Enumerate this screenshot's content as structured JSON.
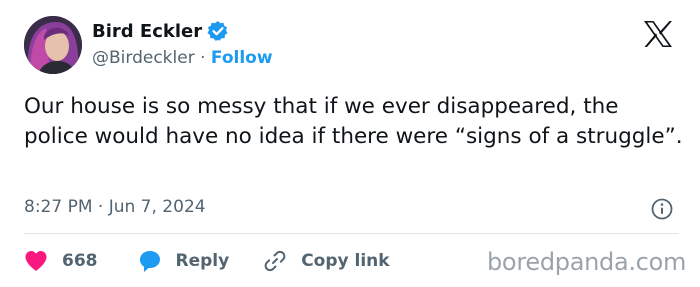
{
  "author": {
    "name": "Bird Eckler",
    "handle": "@Birdeckler",
    "separator": "·",
    "follow_label": "Follow"
  },
  "tweet": {
    "text": "Our house is so messy that if we ever disappeared, the police would have no idea if there were “signs of a struggle”.",
    "time": "8:27 PM",
    "date_separator": "·",
    "date": "Jun 7, 2024"
  },
  "actions": {
    "like_count": "668",
    "reply_label": "Reply",
    "copy_label": "Copy link"
  },
  "watermark": "boredpanda.com",
  "icons": {
    "verified": "verified-badge-icon",
    "platform": "x-logo-icon",
    "info": "info-icon",
    "like": "heart-icon",
    "reply": "speech-bubble-icon",
    "copy": "link-icon"
  },
  "colors": {
    "accent": "#1d9bf0",
    "like": "#f91880",
    "text": "#0f1419",
    "muted": "#536471"
  }
}
